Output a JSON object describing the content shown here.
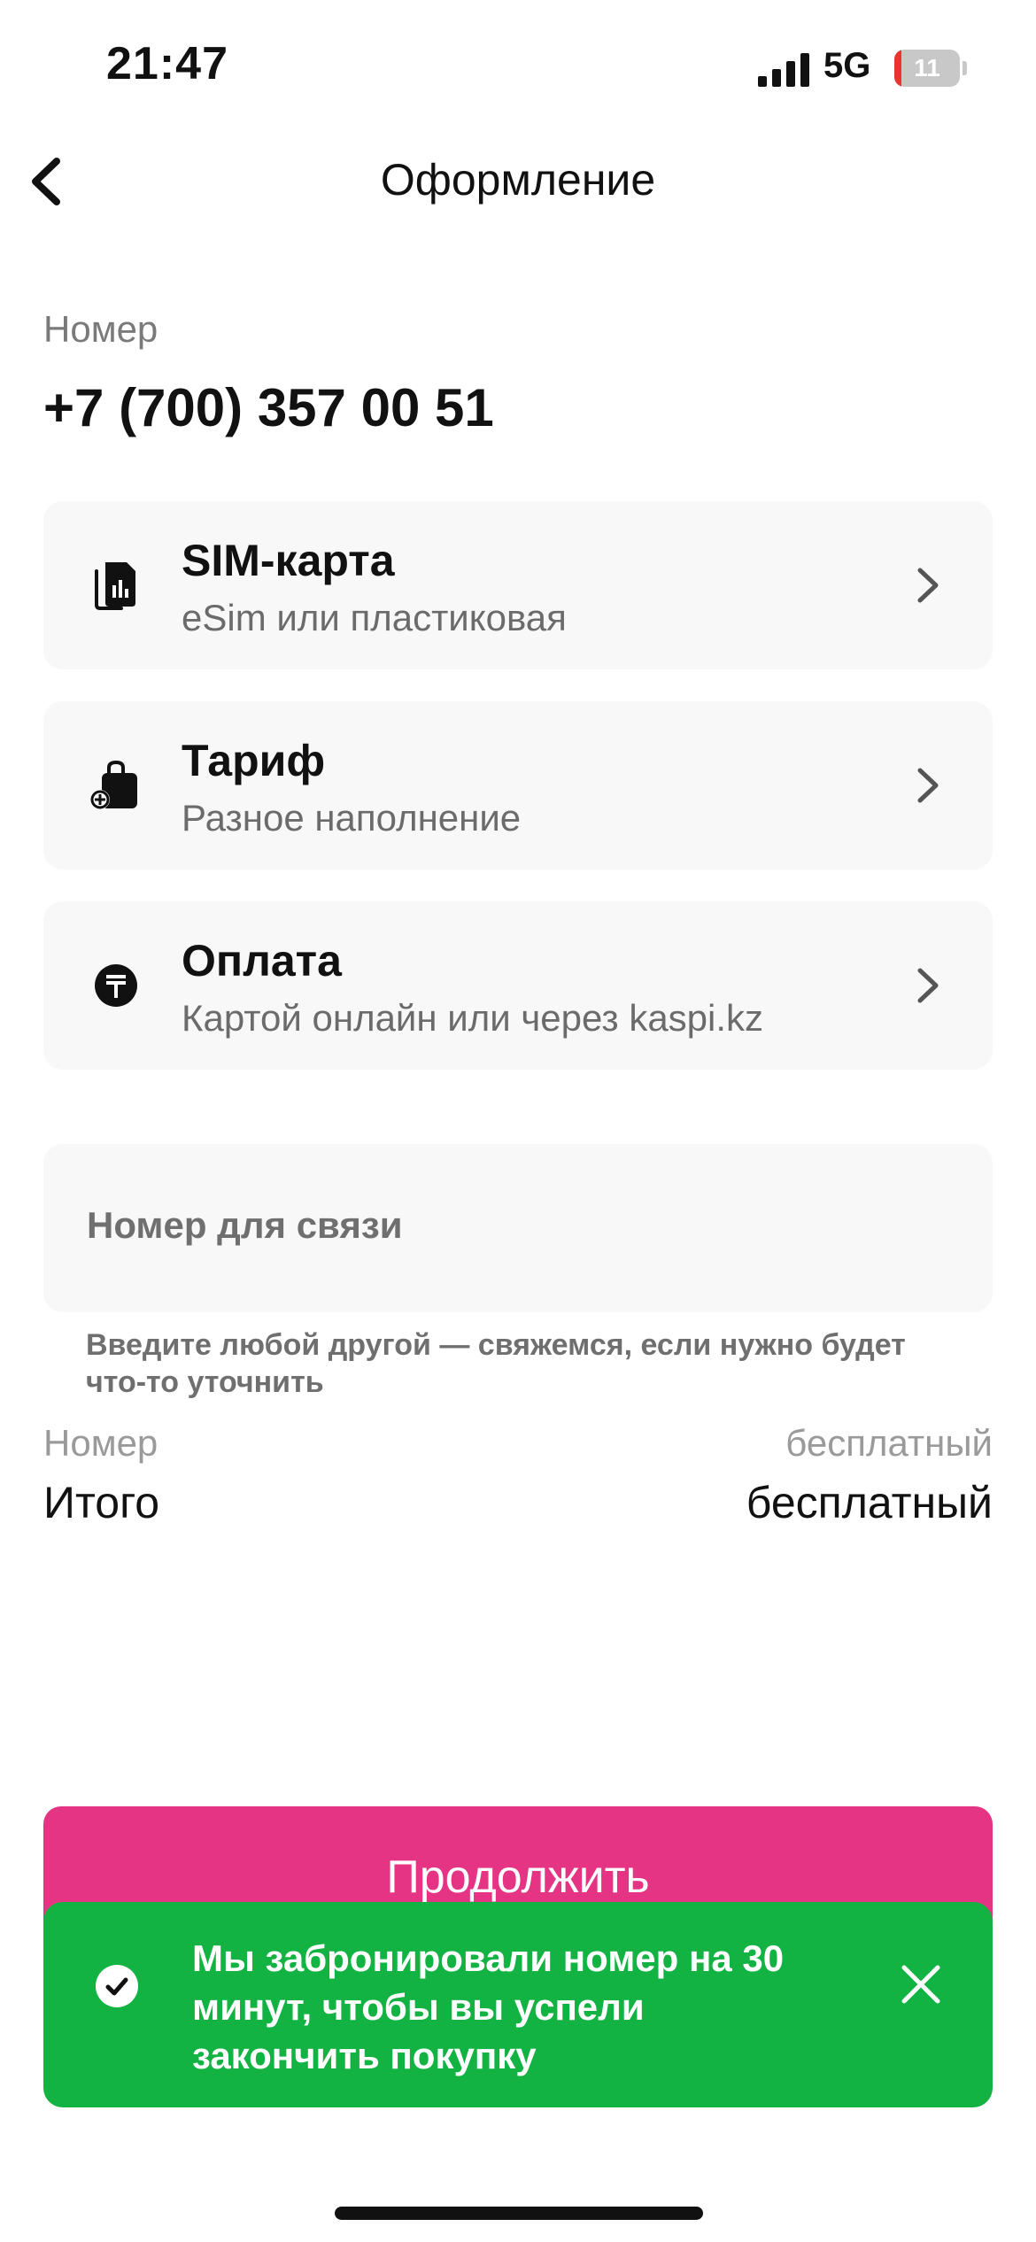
{
  "status_bar": {
    "time": "21:47",
    "network": "5G",
    "battery_text": "11",
    "battery_level": 0.11,
    "battery_color": "#e8362f"
  },
  "header": {
    "title": "Оформление",
    "back_icon": "chevron-left-icon"
  },
  "number": {
    "label": "Номер",
    "value": "+7 (700) 357 00 51"
  },
  "options": [
    {
      "title": "SIM-карта",
      "subtitle": "eSim или пластиковая",
      "icon": "sim-card-icon"
    },
    {
      "title": "Тариф",
      "subtitle": "Разное наполнение",
      "icon": "tariff-bag-icon"
    },
    {
      "title": "Оплата",
      "subtitle": "Картой онлайн или через kaspi.kz",
      "icon": "tenge-icon"
    }
  ],
  "contact": {
    "placeholder": "Номер для связи",
    "hint": "Введите любой другой — свяжемся, если нужно будет что-то уточнить"
  },
  "summary": {
    "rows": [
      {
        "label": "Номер",
        "value": "бесплатный"
      },
      {
        "label": "Итого",
        "value": "бесплатный"
      }
    ]
  },
  "continue_label": "Продолжить",
  "toast": {
    "text": "Мы забронировали номер на 30 минут, чтобы вы успели закончить покупку",
    "color": "#12b342"
  },
  "colors": {
    "accent": "#e63485",
    "success": "#12b342",
    "card_bg": "#f8f8f8"
  }
}
